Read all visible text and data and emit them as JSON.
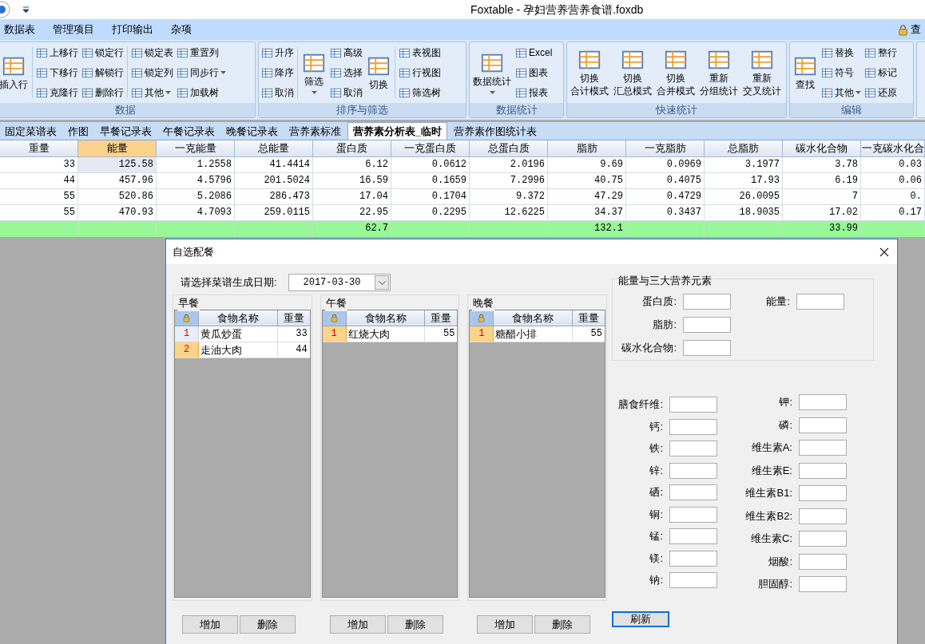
{
  "window": {
    "title": "Foxtable - 孕妇营养营养食谱.foxdb"
  },
  "menu": {
    "items": [
      "数据表",
      "管理项目",
      "打印输出",
      "杂项"
    ],
    "right_item": "查"
  },
  "ribbon": {
    "groups": [
      {
        "label": "数据",
        "columns": [
          {
            "kind": "large",
            "label": "插入行"
          },
          {
            "kind": "separator"
          },
          {
            "kind": "stack",
            "items": [
              {
                "label": "上移行",
                "dropdown": false
              },
              {
                "label": "下移行",
                "dropdown": false
              },
              {
                "label": "克隆行",
                "dropdown": false
              }
            ]
          },
          {
            "kind": "stack",
            "items": [
              {
                "label": "锁定行",
                "dropdown": false
              },
              {
                "label": "解锁行",
                "dropdown": false
              },
              {
                "label": "删除行",
                "dropdown": false
              }
            ]
          },
          {
            "kind": "separator"
          },
          {
            "kind": "stack",
            "items": [
              {
                "label": "锁定表",
                "dropdown": false
              },
              {
                "label": "锁定列",
                "dropdown": false
              },
              {
                "label": "其他",
                "dropdown": true
              }
            ]
          },
          {
            "kind": "stack",
            "items": [
              {
                "label": "重置列",
                "dropdown": false
              },
              {
                "label": "同步行",
                "dropdown": true
              },
              {
                "label": "加载树",
                "dropdown": false
              }
            ]
          }
        ]
      },
      {
        "label": "排序与筛选",
        "columns": [
          {
            "kind": "stack",
            "items": [
              {
                "label": "升序",
                "dropdown": false
              },
              {
                "label": "降序",
                "dropdown": false
              },
              {
                "label": "取消",
                "dropdown": false
              }
            ]
          },
          {
            "kind": "separator"
          },
          {
            "kind": "large",
            "label": "筛选",
            "dropdown": true
          },
          {
            "kind": "stack",
            "items": [
              {
                "label": "高级",
                "dropdown": false
              },
              {
                "label": "选择",
                "dropdown": false
              },
              {
                "label": "取消",
                "dropdown": false
              }
            ]
          },
          {
            "kind": "large",
            "label": "切换"
          },
          {
            "kind": "separator"
          },
          {
            "kind": "stack",
            "items": [
              {
                "label": "表视图",
                "dropdown": false
              },
              {
                "label": "行视图",
                "dropdown": false
              },
              {
                "label": "筛选树",
                "dropdown": false
              }
            ]
          }
        ]
      },
      {
        "label": "数据统计",
        "columns": [
          {
            "kind": "large",
            "label": "数据统计",
            "dropdown": true
          },
          {
            "kind": "stack",
            "items": [
              {
                "label": "Excel",
                "dropdown": false
              },
              {
                "label": "图表",
                "dropdown": false
              },
              {
                "label": "报表",
                "dropdown": false
              }
            ]
          }
        ]
      },
      {
        "label": "快速统计",
        "columns": [
          {
            "kind": "large",
            "label": "切换",
            "sublabel": "合计模式"
          },
          {
            "kind": "large",
            "label": "切换",
            "sublabel": "汇总模式"
          },
          {
            "kind": "large",
            "label": "切换",
            "sublabel": "合并模式"
          },
          {
            "kind": "large",
            "label": "重新",
            "sublabel": "分组统计"
          },
          {
            "kind": "large",
            "label": "重新",
            "sublabel": "交叉统计"
          }
        ]
      },
      {
        "label": "编辑",
        "columns": [
          {
            "kind": "large",
            "label": "查找"
          },
          {
            "kind": "stack",
            "items": [
              {
                "label": "替换",
                "dropdown": false
              },
              {
                "label": "符号",
                "dropdown": false
              },
              {
                "label": "其他",
                "dropdown": true
              }
            ]
          },
          {
            "kind": "stack",
            "items": [
              {
                "label": "整行",
                "dropdown": false
              },
              {
                "label": "标记",
                "dropdown": false
              },
              {
                "label": "还原",
                "dropdown": false
              }
            ]
          }
        ]
      }
    ]
  },
  "sheet_tabs": [
    {
      "label": "固定菜谱表",
      "selected": false
    },
    {
      "label": "作图",
      "selected": false
    },
    {
      "label": "早餐记录表",
      "selected": false
    },
    {
      "label": "午餐记录表",
      "selected": false
    },
    {
      "label": "晚餐记录表",
      "selected": false
    },
    {
      "label": "营养素标准",
      "selected": false
    },
    {
      "label": "营养素分析表_临时",
      "selected": true
    },
    {
      "label": "营养素作图统计表",
      "selected": false
    }
  ],
  "table": {
    "columns": [
      {
        "label": "重量",
        "selected": false
      },
      {
        "label": "能量",
        "selected": true
      },
      {
        "label": "一克能量",
        "selected": false
      },
      {
        "label": "总能量",
        "selected": false
      },
      {
        "label": "蛋白质",
        "selected": false,
        "total": "62.7"
      },
      {
        "label": "一克蛋白质",
        "selected": false
      },
      {
        "label": "总蛋白质",
        "selected": false
      },
      {
        "label": "脂肪",
        "selected": false,
        "total": "132.1"
      },
      {
        "label": "一克脂肪",
        "selected": false
      },
      {
        "label": "总脂肪",
        "selected": false
      },
      {
        "label": "碳水化合物",
        "selected": false,
        "total": "33.99"
      },
      {
        "label": "一克碳水化合",
        "selected": false
      }
    ],
    "rows": [
      {
        "selected": true,
        "cells": [
          "33",
          "125.58",
          "1.2558",
          "41.4414",
          "6.12",
          "0.0612",
          "2.0196",
          "9.69",
          "0.0969",
          "3.1977",
          "3.78",
          "0.03"
        ]
      },
      {
        "selected": false,
        "cells": [
          "44",
          "457.96",
          "4.5796",
          "201.5024",
          "16.59",
          "0.1659",
          "7.2996",
          "40.75",
          "0.4075",
          "17.93",
          "6.19",
          "0.06"
        ]
      },
      {
        "selected": false,
        "cells": [
          "55",
          "520.86",
          "5.2086",
          "286.473",
          "17.04",
          "0.1704",
          "9.372",
          "47.29",
          "0.4729",
          "26.0095",
          "7",
          "0."
        ]
      },
      {
        "selected": false,
        "cells": [
          "55",
          "470.93",
          "4.7093",
          "259.0115",
          "22.95",
          "0.2295",
          "12.6225",
          "34.37",
          "0.3437",
          "18.9035",
          "17.02",
          "0.17"
        ]
      }
    ]
  },
  "dialog": {
    "title": "自选配餐",
    "date_label": "请选择菜谱生成日期:",
    "date_value": "2017-03-30",
    "meals": [
      {
        "title": "早餐",
        "columns": [
          "食物名称",
          "重量"
        ],
        "rows": [
          {
            "number": "1",
            "food": "黄瓜炒蛋",
            "weight": "33",
            "selected": false
          },
          {
            "number": "2",
            "food": "走油大肉",
            "weight": "44",
            "selected": true
          }
        ],
        "buttons": [
          "增加",
          "删除"
        ]
      },
      {
        "title": "午餐",
        "columns": [
          "食物名称",
          "重量"
        ],
        "rows": [
          {
            "number": "1",
            "food": "红烧大肉",
            "weight": "55",
            "selected": true
          }
        ],
        "buttons": [
          "增加",
          "删除"
        ]
      },
      {
        "title": "晚餐",
        "columns": [
          "食物名称",
          "重量"
        ],
        "rows": [
          {
            "number": "1",
            "food": "糖醋小排",
            "weight": "55",
            "selected": true
          }
        ],
        "buttons": [
          "增加",
          "删除"
        ]
      }
    ],
    "energy_group": {
      "title": "能量与三大营养元素",
      "fields": [
        {
          "label": "蛋白质:"
        },
        {
          "label": "脂肪:"
        },
        {
          "label": "碳水化合物:"
        }
      ],
      "side_fields": [
        {
          "label": "能量:"
        }
      ]
    },
    "nutrients_left": [
      {
        "label": "膳食纤维:"
      },
      {
        "label": "钙:"
      },
      {
        "label": "铁:"
      },
      {
        "label": "锌:"
      },
      {
        "label": "硒:"
      },
      {
        "label": "铜:"
      },
      {
        "label": "锰:"
      },
      {
        "label": "镁:"
      },
      {
        "label": "钠:"
      }
    ],
    "nutrients_right": [
      {
        "label": "钾:"
      },
      {
        "label": "磷:"
      },
      {
        "label": "维生素A:"
      },
      {
        "label": "维生素E:"
      },
      {
        "label": "维生素B1:"
      },
      {
        "label": "维生素B2:"
      },
      {
        "label": "维生素C:"
      },
      {
        "label": "烟酸:"
      },
      {
        "label": "胆固醇:"
      }
    ],
    "refresh_button": "刷新"
  }
}
